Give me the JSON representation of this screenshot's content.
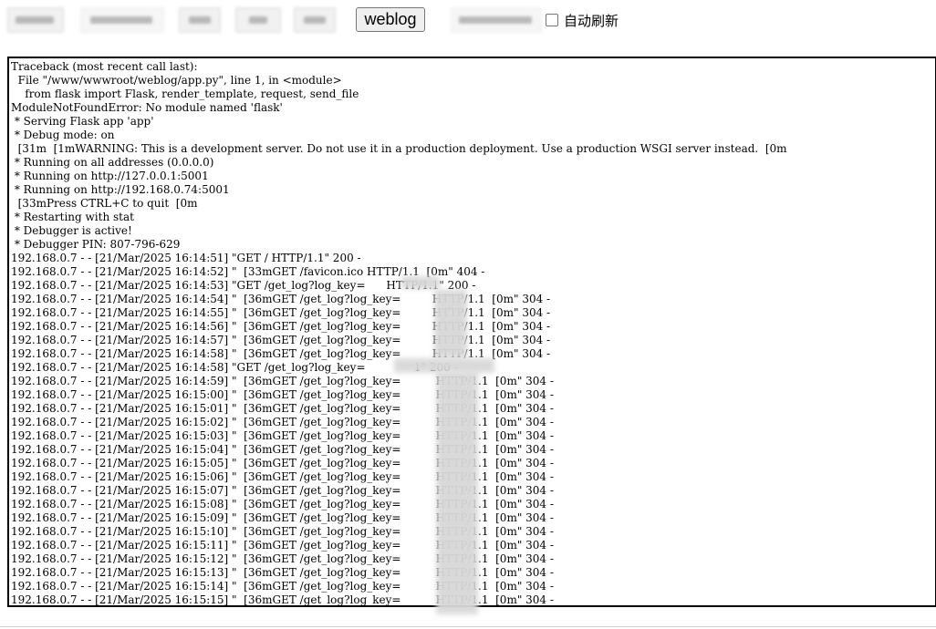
{
  "toolbar": {
    "weblog_button": "weblog",
    "auto_refresh_label": "自动刷新",
    "auto_refresh_checked": false
  },
  "log": {
    "lines": [
      "Traceback (most recent call last):",
      "  File \"/www/wwwroot/weblog/app.py\", line 1, in <module>",
      "    from flask import Flask, render_template, request, send_file",
      "ModuleNotFoundError: No module named 'flask'",
      " * Serving Flask app 'app'",
      " * Debug mode: on",
      "  [31m  [1mWARNING: This is a development server. Do not use it in a production deployment. Use a production WSGI server instead.  [0m",
      " * Running on all addresses (0.0.0.0)",
      " * Running on http://127.0.0.1:5001",
      " * Running on http://192.168.0.74:5001",
      "  [33mPress CTRL+C to quit  [0m",
      " * Restarting with stat",
      " * Debugger is active!",
      " * Debugger PIN: 807-796-629",
      "192.168.0.7 - - [21/Mar/2025 16:14:51] \"GET / HTTP/1.1\" 200 -",
      "192.168.0.7 - - [21/Mar/2025 16:14:52] \"  [33mGET /favicon.ico HTTP/1.1  [0m\" 404 -",
      "192.168.0.7 - - [21/Mar/2025 16:14:53] \"GET /get_log?log_key=      HTTP/1.1\" 200 -",
      "192.168.0.7 - - [21/Mar/2025 16:14:54] \"  [36mGET /get_log?log_key=         HTTP/1.1  [0m\" 304 -",
      "192.168.0.7 - - [21/Mar/2025 16:14:55] \"  [36mGET /get_log?log_key=         HTTP/1.1  [0m\" 304 -",
      "192.168.0.7 - - [21/Mar/2025 16:14:56] \"  [36mGET /get_log?log_key=         HTTP/1.1  [0m\" 304 -",
      "192.168.0.7 - - [21/Mar/2025 16:14:57] \"  [36mGET /get_log?log_key=         HTTP/1.1  [0m\" 304 -",
      "192.168.0.7 - - [21/Mar/2025 16:14:58] \"  [36mGET /get_log?log_key=         HTTP/1.1  [0m\" 304 -",
      "192.168.0.7 - - [21/Mar/2025 16:14:58] \"GET /get_log?log_key=              1\" 200 -",
      "192.168.0.7 - - [21/Mar/2025 16:14:59] \"  [36mGET /get_log?log_key=          HTTP/1.1  [0m\" 304 -",
      "192.168.0.7 - - [21/Mar/2025 16:15:00] \"  [36mGET /get_log?log_key=          HTTP/1.1  [0m\" 304 -",
      "192.168.0.7 - - [21/Mar/2025 16:15:01] \"  [36mGET /get_log?log_key=          HTTP/1.1  [0m\" 304 -",
      "192.168.0.7 - - [21/Mar/2025 16:15:02] \"  [36mGET /get_log?log_key=          HTTP/1.1  [0m\" 304 -",
      "192.168.0.7 - - [21/Mar/2025 16:15:03] \"  [36mGET /get_log?log_key=          HTTP/1.1  [0m\" 304 -",
      "192.168.0.7 - - [21/Mar/2025 16:15:04] \"  [36mGET /get_log?log_key=          HTTP/1.1  [0m\" 304 -",
      "192.168.0.7 - - [21/Mar/2025 16:15:05] \"  [36mGET /get_log?log_key=          HTTP/1.1  [0m\" 304 -",
      "192.168.0.7 - - [21/Mar/2025 16:15:06] \"  [36mGET /get_log?log_key=          HTTP/1.1  [0m\" 304 -",
      "192.168.0.7 - - [21/Mar/2025 16:15:07] \"  [36mGET /get_log?log_key=          HTTP/1.1  [0m\" 304 -",
      "192.168.0.7 - - [21/Mar/2025 16:15:08] \"  [36mGET /get_log?log_key=          HTTP/1.1  [0m\" 304 -",
      "192.168.0.7 - - [21/Mar/2025 16:15:09] \"  [36mGET /get_log?log_key=          HTTP/1.1  [0m\" 304 -",
      "192.168.0.7 - - [21/Mar/2025 16:15:10] \"  [36mGET /get_log?log_key=          HTTP/1.1  [0m\" 304 -",
      "192.168.0.7 - - [21/Mar/2025 16:15:11] \"  [36mGET /get_log?log_key=          HTTP/1.1  [0m\" 304 -",
      "192.168.0.7 - - [21/Mar/2025 16:15:12] \"  [36mGET /get_log?log_key=          HTTP/1.1  [0m\" 304 -",
      "192.168.0.7 - - [21/Mar/2025 16:15:13] \"  [36mGET /get_log?log_key=          HTTP/1.1  [0m\" 304 -",
      "192.168.0.7 - - [21/Mar/2025 16:15:14] \"  [36mGET /get_log?log_key=          HTTP/1.1  [0m\" 304 -",
      "192.168.0.7 - - [21/Mar/2025 16:15:15] \"  [36mGET /get_log?log_key=          HTTP/1.1  [0m\" 304 -"
    ]
  }
}
